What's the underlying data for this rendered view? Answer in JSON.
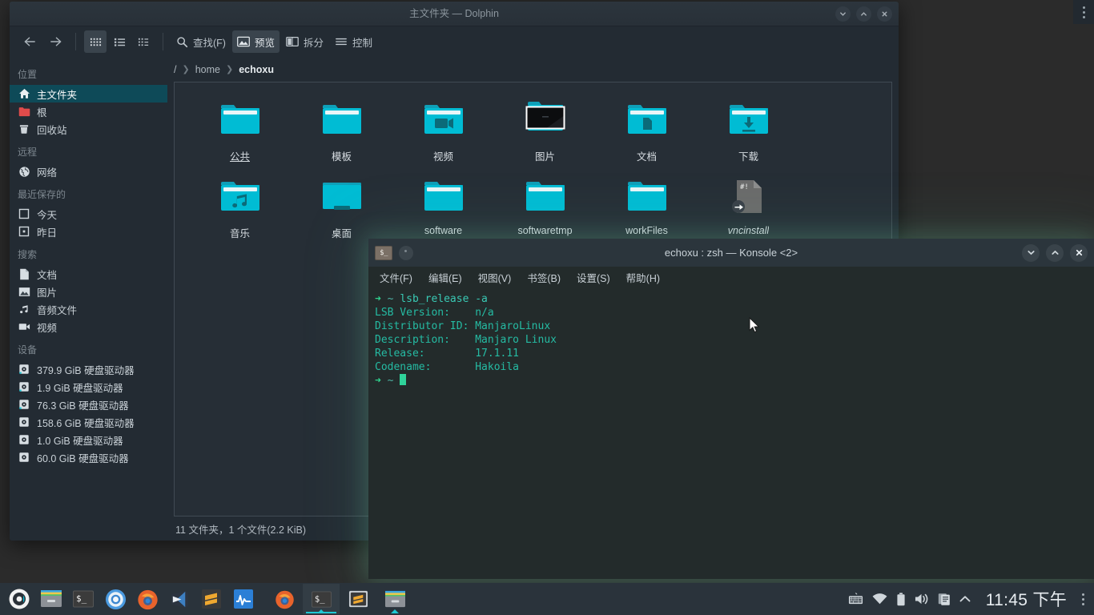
{
  "desktop": {
    "background_color": "#2b2b2b",
    "toolbox_icon": "kebab-menu-icon"
  },
  "dolphin": {
    "title": "主文件夹 — Dolphin",
    "window_buttons": [
      {
        "name": "minimize",
        "glyph": "chevron-down-icon"
      },
      {
        "name": "maximize",
        "glyph": "chevron-up-icon"
      },
      {
        "name": "close",
        "glyph": "close-icon"
      }
    ],
    "toolbar": {
      "back": "back-arrow-icon",
      "forward": "forward-arrow-icon",
      "view_modes": [
        {
          "name": "icons-view",
          "icon": "grid-icon",
          "active": true
        },
        {
          "name": "details-view",
          "icon": "list-icon",
          "active": false
        },
        {
          "name": "compact-view",
          "icon": "compact-icon",
          "active": false
        }
      ],
      "find_label": "查找(F)",
      "preview_label": "预览",
      "split_label": "拆分",
      "control_label": "控制"
    },
    "breadcrumb": {
      "root": "/",
      "items": [
        "home"
      ],
      "current": "echoxu"
    },
    "places": {
      "sections": [
        {
          "title": "位置",
          "items": [
            {
              "label": "主文件夹",
              "icon": "home-icon",
              "selected": true
            },
            {
              "label": "根",
              "icon": "red-folder-icon",
              "selected": false
            },
            {
              "label": "回收站",
              "icon": "trash-icon",
              "selected": false
            }
          ]
        },
        {
          "title": "远程",
          "items": [
            {
              "label": "网络",
              "icon": "globe-icon",
              "selected": false
            }
          ]
        },
        {
          "title": "最近保存的",
          "items": [
            {
              "label": "今天",
              "icon": "calendar-today-icon",
              "selected": false
            },
            {
              "label": "昨日",
              "icon": "calendar-yesterday-icon",
              "selected": false
            }
          ]
        },
        {
          "title": "搜索",
          "items": [
            {
              "label": "文档",
              "icon": "document-icon",
              "selected": false
            },
            {
              "label": "图片",
              "icon": "image-icon",
              "selected": false
            },
            {
              "label": "音频文件",
              "icon": "music-note-icon",
              "selected": false
            },
            {
              "label": "视频",
              "icon": "video-camera-icon",
              "selected": false
            }
          ]
        },
        {
          "title": "设备",
          "items": [
            {
              "label": "379.9 GiB 硬盘驱动器",
              "icon": "hard-drive-icon",
              "selected": false
            },
            {
              "label": "1.9 GiB 硬盘驱动器",
              "icon": "hard-drive-icon",
              "selected": false
            },
            {
              "label": "76.3 GiB 硬盘驱动器",
              "icon": "hard-drive-icon",
              "selected": false
            },
            {
              "label": "158.6 GiB 硬盘驱动器",
              "icon": "hard-drive-icon",
              "selected": false
            },
            {
              "label": "1.0 GiB 硬盘驱动器",
              "icon": "hard-drive-icon",
              "selected": false
            },
            {
              "label": "60.0 GiB 硬盘驱动器",
              "icon": "hard-drive-icon",
              "selected": false
            }
          ]
        }
      ]
    },
    "files": [
      {
        "name": "公共",
        "type": "folder",
        "emblem": "none",
        "hover": true
      },
      {
        "name": "模板",
        "type": "folder",
        "emblem": "none",
        "hover": false
      },
      {
        "name": "视频",
        "type": "folder",
        "emblem": "video-camera-icon",
        "hover": false
      },
      {
        "name": "图片",
        "type": "folder-thumbnail",
        "emblem": "photo-thumbnail",
        "hover": false
      },
      {
        "name": "文档",
        "type": "folder",
        "emblem": "document-icon",
        "hover": false
      },
      {
        "name": "下载",
        "type": "folder",
        "emblem": "download-arrow-icon",
        "hover": false
      },
      {
        "name": "音乐",
        "type": "folder",
        "emblem": "music-note-icon",
        "hover": false
      },
      {
        "name": "桌面",
        "type": "folder-desktop",
        "emblem": "none",
        "hover": false
      },
      {
        "name": "software",
        "type": "folder",
        "emblem": "none",
        "hover": false
      },
      {
        "name": "softwaretmp",
        "type": "folder",
        "emblem": "none",
        "hover": false
      },
      {
        "name": "workFiles",
        "type": "folder",
        "emblem": "none",
        "hover": false
      },
      {
        "name": "vncinstall",
        "type": "script-symlink",
        "emblem": "symlink-arrow-icon",
        "hover": false,
        "badge": "#!"
      }
    ],
    "statusbar": "11 文件夹，1 个文件(2.2 KiB)",
    "colors": {
      "selection": "#0e4a58",
      "folder": "#00b8d4",
      "panel_bg": "#232b33"
    }
  },
  "konsole": {
    "title": "echoxu : zsh — Konsole <2>",
    "app_icon": "terminal-icon",
    "tab_icon": "tab-dot-icon",
    "window_buttons": [
      {
        "name": "minimize",
        "glyph": "chevron-down-icon"
      },
      {
        "name": "maximize",
        "glyph": "chevron-up-icon"
      },
      {
        "name": "close",
        "glyph": "close-icon"
      }
    ],
    "menubar": [
      "文件(F)",
      "编辑(E)",
      "视图(V)",
      "书签(B)",
      "设置(S)",
      "帮助(H)"
    ],
    "terminal": {
      "prompt_arrow": "➜",
      "prompt_path": "~",
      "command": "lsb_release -a",
      "output_lines": [
        "LSB Version:    n/a",
        "Distributor ID: ManjaroLinux",
        "Description:    Manjaro Linux",
        "Release:        17.1.11",
        "Codename:       Hakoila"
      ],
      "colors": {
        "background": "#232b2b",
        "prompt": "#2fd38e",
        "text": "#25bba3"
      }
    }
  },
  "panel": {
    "launchers": [
      {
        "name": "manjaro-menu-icon",
        "label": "Manjaro"
      },
      {
        "name": "dolphin-icon",
        "label": "Dolphin"
      },
      {
        "name": "konsole-icon",
        "label": "Konsole"
      },
      {
        "name": "chromium-icon",
        "label": "Chromium"
      },
      {
        "name": "firefox-icon",
        "label": "Firefox"
      },
      {
        "name": "vscode-icon",
        "label": "Visual Studio Code"
      },
      {
        "name": "sublime-icon",
        "label": "Sublime Text"
      },
      {
        "name": "monitor-icon",
        "label": "System Monitor"
      }
    ],
    "tasks": [
      {
        "name": "firefox-task",
        "icon": "firefox-icon",
        "active": false,
        "indicator": "none"
      },
      {
        "name": "konsole-task",
        "icon": "konsole-icon",
        "active": true,
        "indicator": "underline-caret"
      },
      {
        "name": "sublime-task",
        "icon": "sublime-icon",
        "active": false,
        "indicator": "none"
      },
      {
        "name": "dolphin-task",
        "icon": "dolphin-icon",
        "active": false,
        "indicator": "caret"
      }
    ],
    "tray": [
      {
        "name": "keyboard-icon"
      },
      {
        "name": "wifi-icon"
      },
      {
        "name": "battery-icon"
      },
      {
        "name": "volume-icon"
      },
      {
        "name": "clipboard-icon"
      },
      {
        "name": "show-hidden-arrow-icon"
      }
    ],
    "clock": "11:45 下午",
    "kebab": "panel-kebab-icon",
    "accent_color": "#1fc8d4"
  }
}
